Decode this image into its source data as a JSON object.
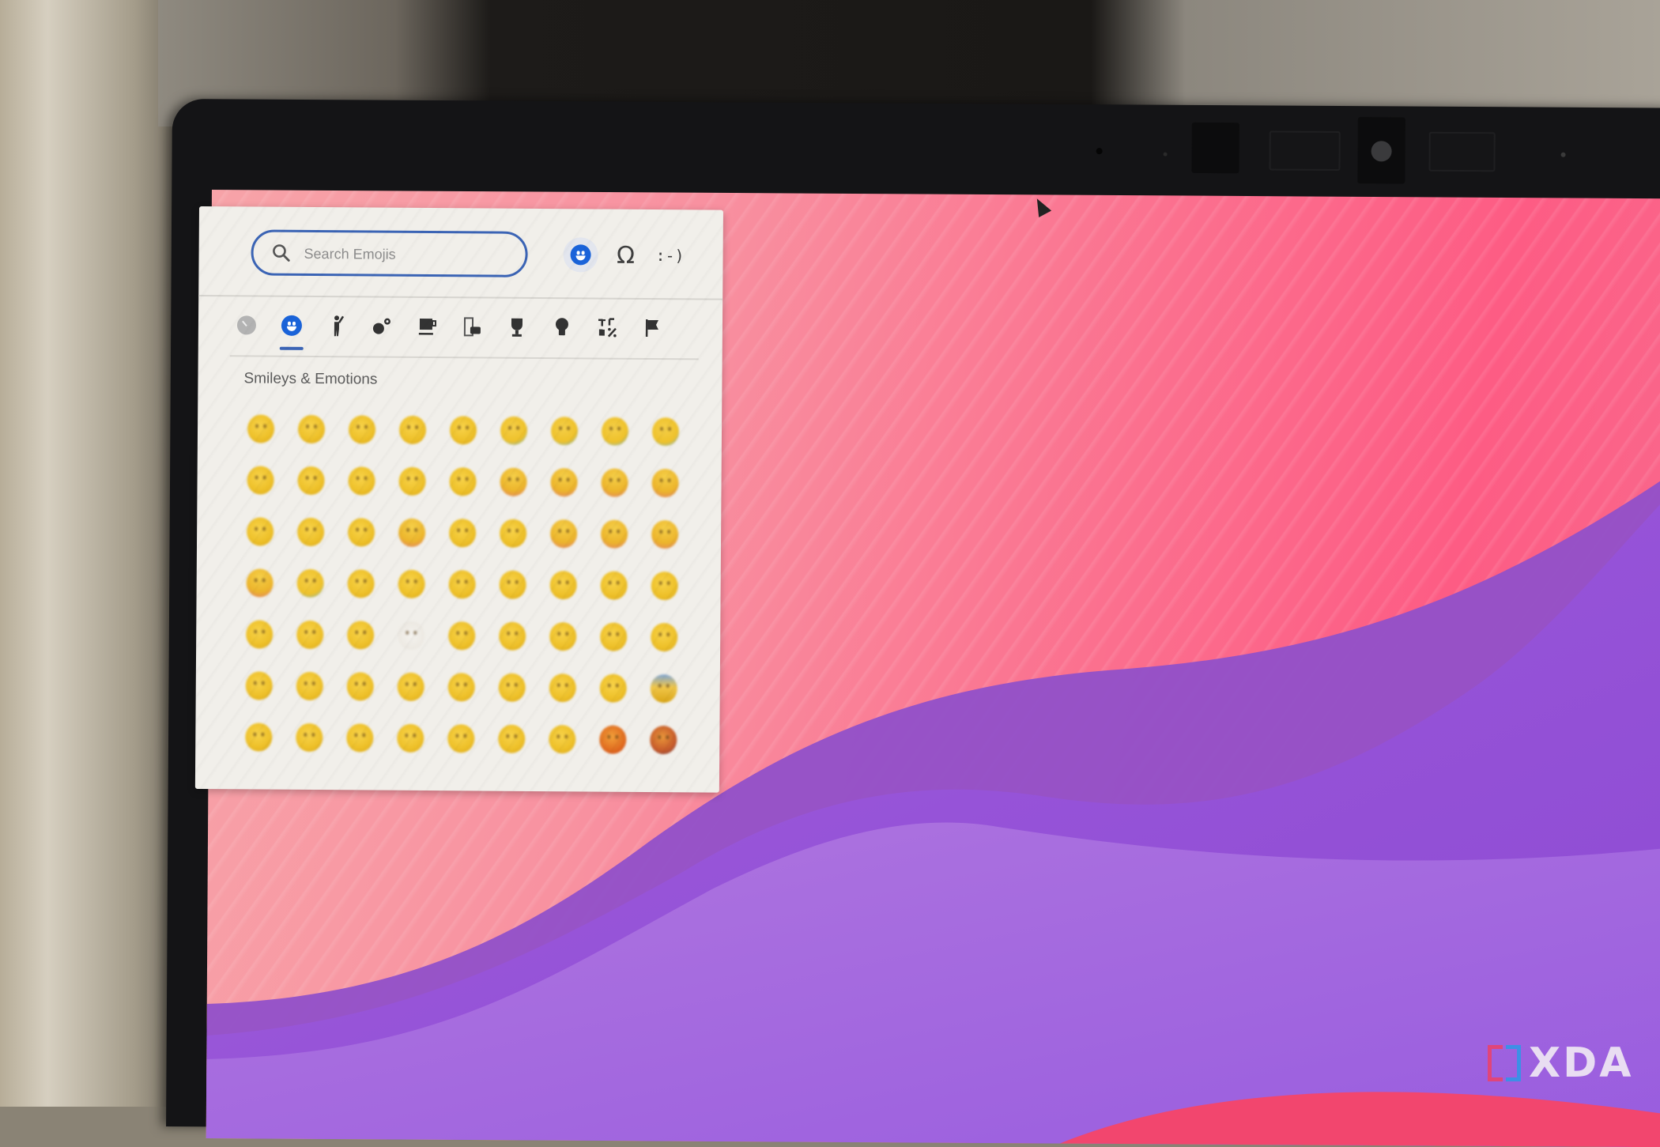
{
  "emoji_picker": {
    "search": {
      "placeholder": "Search Emojis",
      "value": ""
    },
    "modes": [
      {
        "name": "emoji",
        "icon": "smiley-face-icon",
        "active": true
      },
      {
        "name": "symbols",
        "label": "Ω",
        "active": false
      },
      {
        "name": "emoticons",
        "label": ":-)",
        "active": false
      }
    ],
    "categories": [
      {
        "name": "recent",
        "icon": "clock-icon",
        "glyph": ""
      },
      {
        "name": "smileys-emotions",
        "icon": "smiley-face-icon",
        "glyph": "",
        "active": true
      },
      {
        "name": "people",
        "icon": "person-waving-icon",
        "glyph": "🚶"
      },
      {
        "name": "animals-nature",
        "icon": "paw-flower-icon",
        "glyph": "✿"
      },
      {
        "name": "food-drink",
        "icon": "coffee-cup-icon",
        "glyph": "☕"
      },
      {
        "name": "travel-places",
        "icon": "building-car-icon",
        "glyph": "🏢"
      },
      {
        "name": "activities",
        "icon": "trophy-icon",
        "glyph": "🏆"
      },
      {
        "name": "objects",
        "icon": "lightbulb-icon",
        "glyph": "💡"
      },
      {
        "name": "symbols",
        "icon": "symbols-icon",
        "glyph": "%"
      },
      {
        "name": "flags",
        "icon": "flag-icon",
        "glyph": "⚑"
      }
    ],
    "section_title": "Smileys & Emotions",
    "emoji_rows": [
      [
        "grinning",
        "grinning-big-eyes",
        "grinning-smiling-eyes",
        "beaming",
        "squinting",
        "sweat-smile",
        "tears-of-joy-tilted",
        "rolling-on-floor-laughing",
        "loudly-laughing"
      ],
      [
        "slightly-smiling",
        "upside-down",
        "winking",
        "smiling-eyes",
        "halo",
        "smiling-hearts",
        "heart-eyes",
        "star-struck",
        "party"
      ],
      [
        "kissing",
        "kissing-smiling",
        "kissing-closed-eyes",
        "kissing-heart",
        "smiling-tear",
        "yum",
        "tongue",
        "winking-tongue",
        "zany"
      ],
      [
        "squinting-tongue",
        "money-mouth",
        "hugging",
        "hand-over-mouth",
        "shushing",
        "thinking",
        "salute",
        "zipper-mouth",
        "raised-eyebrow"
      ],
      [
        "neutral",
        "pleading",
        "grimacing",
        "dotted-line-face",
        "expressionless",
        "no-mouth",
        "smirk",
        "face-in-clouds",
        "unamused"
      ],
      [
        "neutral-mouth",
        "thinking-frown",
        "kiss-blush",
        "hushed",
        "blushing-hand",
        "yawning",
        "melting",
        "peeking",
        "cold-face"
      ],
      [
        "face-with-raised-eyebrow",
        "monocle",
        "worried",
        "rolling-eyes",
        "persevering",
        "steam-from-nose",
        "angry",
        "pouting",
        "cursing"
      ]
    ]
  },
  "watermark": {
    "text": "XDA",
    "colors": {
      "bracket_left": "#e0457a",
      "bracket_right": "#3d8fe6"
    }
  },
  "colors": {
    "accent": "#3b64b5",
    "active_icon": "#1a63d9",
    "wallpaper_pink": "#fb6f8e",
    "wallpaper_purple": "#9b5ad8"
  }
}
